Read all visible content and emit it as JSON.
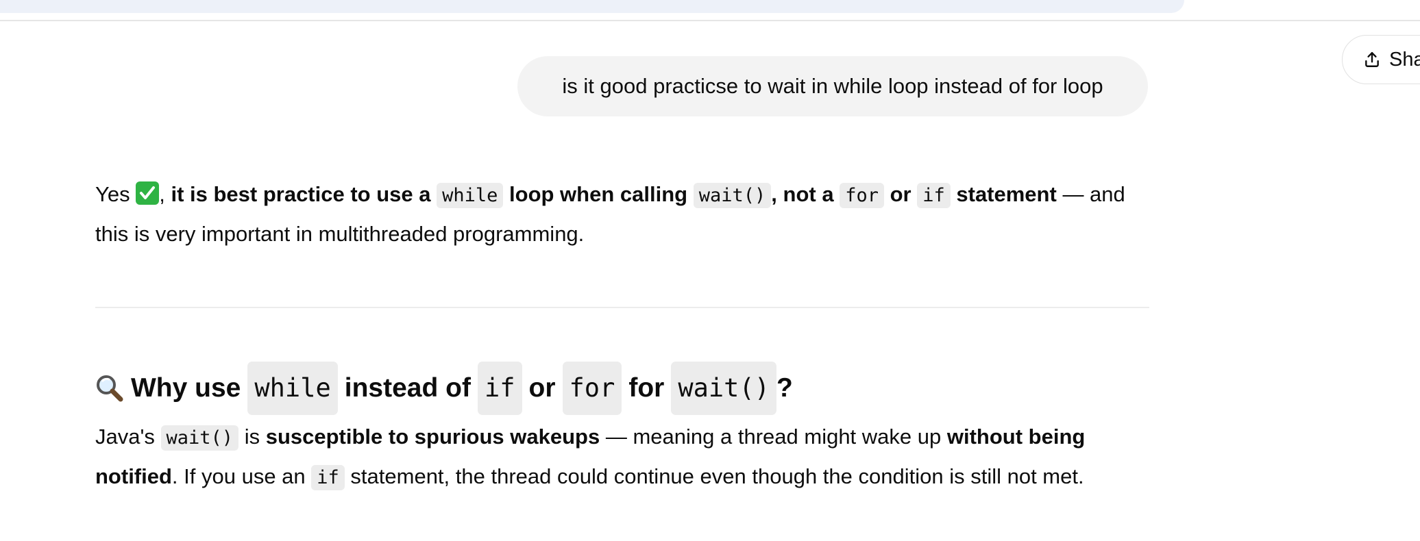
{
  "header": {
    "share_label": "Sha"
  },
  "user_message": "is it good practicse to wait in while loop instead of for loop",
  "answer": {
    "p1": {
      "yes": "Yes",
      "comma1": ",",
      "bold1": "it is best practice to use a",
      "code_while": "while",
      "bold2": "loop when calling",
      "code_wait": "wait()",
      "comma2": ",",
      "bold3": "not a",
      "code_for": "for",
      "bold4": "or",
      "code_if": "if",
      "bold5": "statement",
      "tail": "— and this is very important in multithreaded programming."
    },
    "heading": {
      "t1": "Why use",
      "c1": "while",
      "t2": "instead of",
      "c2": "if",
      "t3": "or",
      "c3": "for",
      "t4": "for",
      "c4": "wait()",
      "t5": "?"
    },
    "p2": {
      "t1": "Java's",
      "c1": "wait()",
      "t2": "is",
      "b1": "susceptible to spurious wakeups",
      "t3": "— meaning a thread might wake up",
      "b2": "without being notified",
      "t4": ". If you use an",
      "c2": "if",
      "t5": "statement, the thread could continue even though the condition is still not met."
    }
  },
  "icons": {
    "share": "share-icon",
    "check": "check-mark-emoji",
    "magnifier": "magnifying-glass-emoji"
  },
  "colors": {
    "user_bubble_bg": "#f3f3f3",
    "code_bg": "#ececec",
    "check_green": "#2fb344"
  }
}
